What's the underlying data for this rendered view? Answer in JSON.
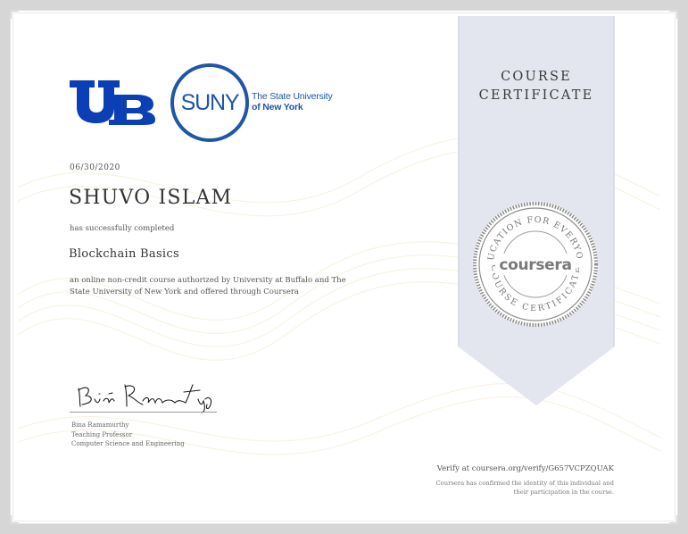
{
  "logos": {
    "ub_mark": "UB",
    "suny_mark": "SUNY",
    "suny_line1": "The State University",
    "suny_line2": "of New York"
  },
  "certificate": {
    "date": "06/30/2020",
    "recipient_name": "SHUVO ISLAM",
    "completion_text": "has successfully completed",
    "course_name": "Blockchain Basics",
    "description": "an online non-credit course authorized by University at Buffalo and The State University of New York and offered through Coursera",
    "title_line1": "COURSE",
    "title_line2": "CERTIFICATE"
  },
  "signer": {
    "name": "Bina Ramamurthy",
    "role": "Teaching Professor",
    "department": "Computer Science and Engineering"
  },
  "seal": {
    "top_text": "EDUCATION FOR EVERYONE",
    "brand": "coursera",
    "bottom_text": "COURSE CERTIFICATE"
  },
  "verification": {
    "verify_text": "Verify at coursera.org/verify/G657VCPZQUAK",
    "confirm_line1": "Coursera has confirmed the identity of this individual and",
    "confirm_line2": "their participation in the course."
  },
  "colors": {
    "ub_blue": "#0a3fb5",
    "suny_blue": "#1f56a8",
    "ribbon": "#e3e6ef",
    "seal_gray": "#8e8e8e"
  }
}
